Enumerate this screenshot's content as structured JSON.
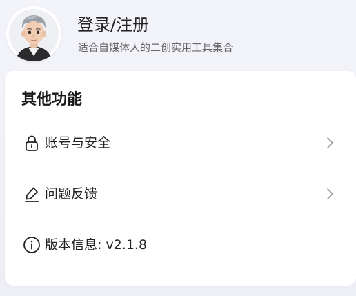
{
  "profile": {
    "login_label": "登录/注册",
    "tagline": "适合自媒体人的二创实用工具集合"
  },
  "section": {
    "title": "其他功能",
    "items": [
      {
        "label": "账号与安全",
        "icon": "lock-icon",
        "has_chevron": true
      },
      {
        "label": "问题反馈",
        "icon": "edit-icon",
        "has_chevron": true
      },
      {
        "label": "版本信息: v2.1.8",
        "icon": "info-icon",
        "has_chevron": false
      }
    ]
  },
  "colors": {
    "page_background": "#f1f1f8",
    "card_background": "#ffffff",
    "primary_text": "#222222",
    "secondary_text": "#666666",
    "chevron": "#9a9a9a",
    "divider": "#ececec"
  }
}
